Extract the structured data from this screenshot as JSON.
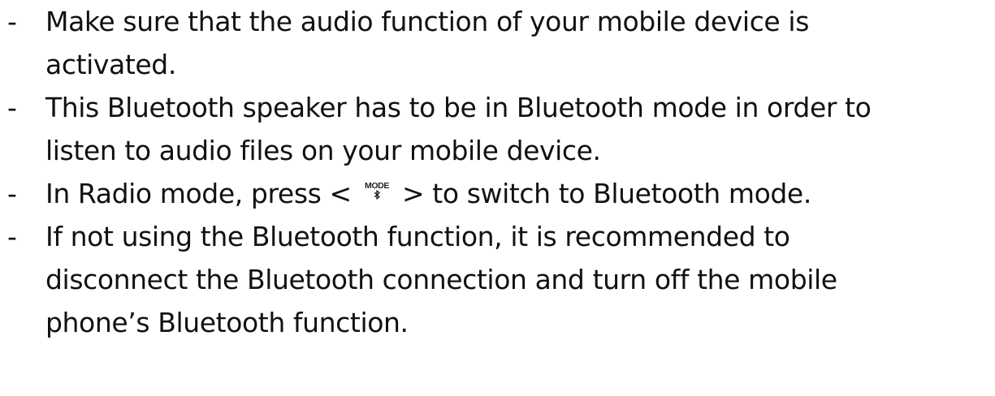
{
  "bullets": [
    {
      "marker": "-",
      "lines": [
        "Make sure that the audio function of your mobile device is",
        "activated."
      ]
    },
    {
      "marker": "-",
      "lines": [
        "This Bluetooth speaker has to be in Bluetooth mode in order to",
        "listen to audio files on your mobile device."
      ]
    },
    {
      "marker": "-",
      "text_before": "In Radio mode, press <",
      "key_label": "MODE",
      "key_icon": "bluetooth-icon",
      "text_after": "> to switch to Bluetooth mode."
    },
    {
      "marker": "-",
      "lines": [
        "If not using the Bluetooth function, it is recommended to",
        "disconnect the Bluetooth connection and turn off the mobile",
        "phone’s Bluetooth function."
      ]
    }
  ]
}
